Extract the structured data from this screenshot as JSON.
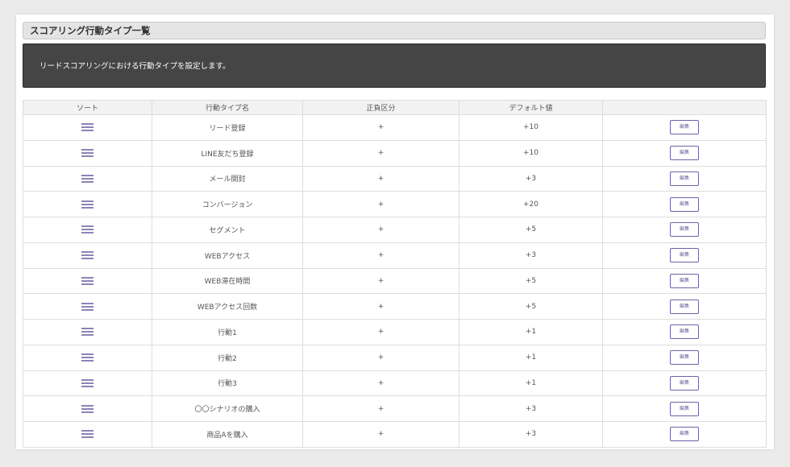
{
  "page": {
    "title": "スコアリング行動タイプ一覧",
    "description": "リードスコアリングにおける行動タイプを設定します。"
  },
  "table": {
    "headers": {
      "sort": "ソート",
      "name": "行動タイプ名",
      "sign": "正負区分",
      "default": "デフォルト値",
      "action": ""
    },
    "rows": [
      {
        "name": "リード登録",
        "sign": "+",
        "default": "+10",
        "edit": "編集"
      },
      {
        "name": "LINE友だち登録",
        "sign": "+",
        "default": "+10",
        "edit": "編集"
      },
      {
        "name": "メール開封",
        "sign": "+",
        "default": "+3",
        "edit": "編集"
      },
      {
        "name": "コンバージョン",
        "sign": "+",
        "default": "+20",
        "edit": "編集"
      },
      {
        "name": "セグメント",
        "sign": "+",
        "default": "+5",
        "edit": "編集"
      },
      {
        "name": "WEBアクセス",
        "sign": "+",
        "default": "+3",
        "edit": "編集"
      },
      {
        "name": "WEB滞在時間",
        "sign": "+",
        "default": "+5",
        "edit": "編集"
      },
      {
        "name": "WEBアクセス回数",
        "sign": "+",
        "default": "+5",
        "edit": "編集"
      },
      {
        "name": "行動1",
        "sign": "+",
        "default": "+1",
        "edit": "編集"
      },
      {
        "name": "行動2",
        "sign": "+",
        "default": "+1",
        "edit": "編集"
      },
      {
        "name": "行動3",
        "sign": "+",
        "default": "+1",
        "edit": "編集"
      },
      {
        "name": "〇〇シナリオの購入",
        "sign": "+",
        "default": "+3",
        "edit": "編集"
      },
      {
        "name": "商品Aを購入",
        "sign": "+",
        "default": "+3",
        "edit": "編集"
      }
    ]
  },
  "icons": {
    "sort_handle": "drag-handle-icon"
  },
  "colors": {
    "info_background": "#454545",
    "accent": "#6b63a5",
    "handle": "#8d84b5"
  }
}
